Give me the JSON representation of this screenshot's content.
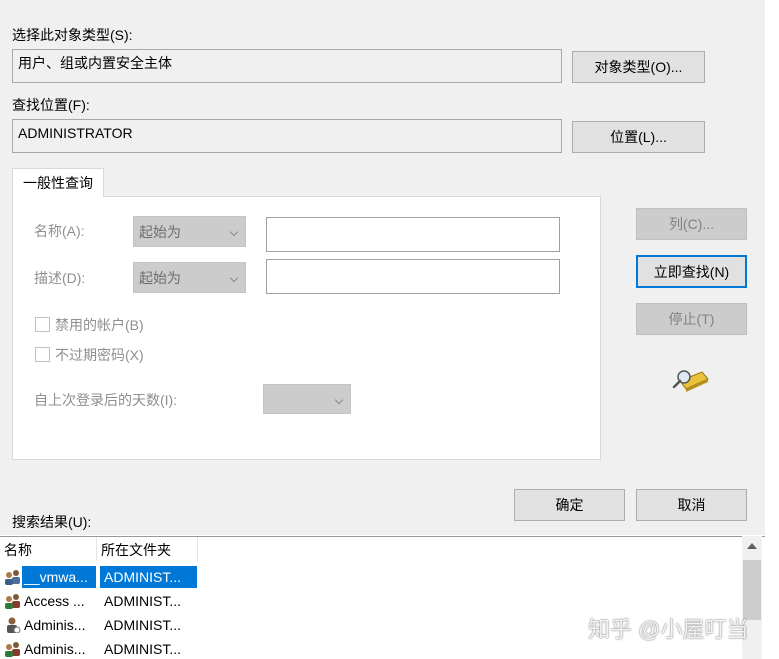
{
  "object_type": {
    "label": "选择此对象类型(S):",
    "value": "用户、组或内置安全主体",
    "button": "对象类型(O)..."
  },
  "location": {
    "label": "查找位置(F):",
    "value": "ADMINISTRATOR",
    "button": "位置(L)..."
  },
  "query": {
    "tab": "一般性查询",
    "name_label": "名称(A):",
    "name_mode": "起始为",
    "desc_label": "描述(D):",
    "desc_mode": "起始为",
    "disabled_accounts": "禁用的帐户(B)",
    "non_expiring_pw": "不过期密码(X)",
    "days_since_login": "自上次登录后的天数(I):"
  },
  "side_buttons": {
    "columns": "列(C)...",
    "find_now": "立即查找(N)",
    "stop": "停止(T)"
  },
  "footer": {
    "ok": "确定",
    "cancel": "取消"
  },
  "results": {
    "label": "搜索结果(U):",
    "headers": [
      "名称",
      "所在文件夹"
    ],
    "rows": [
      {
        "name": "__vmwa...",
        "folder": "ADMINIST...",
        "selected": true
      },
      {
        "name": "Access ...",
        "folder": "ADMINIST...",
        "selected": false
      },
      {
        "name": "Adminis...",
        "folder": "ADMINIST...",
        "selected": false
      },
      {
        "name": "Adminis...",
        "folder": "ADMINIST...",
        "selected": false
      }
    ]
  },
  "watermark": "知乎 @小屋叮当",
  "colors": {
    "accent": "#0078d7",
    "dialog_bg": "#f0f0f0"
  }
}
